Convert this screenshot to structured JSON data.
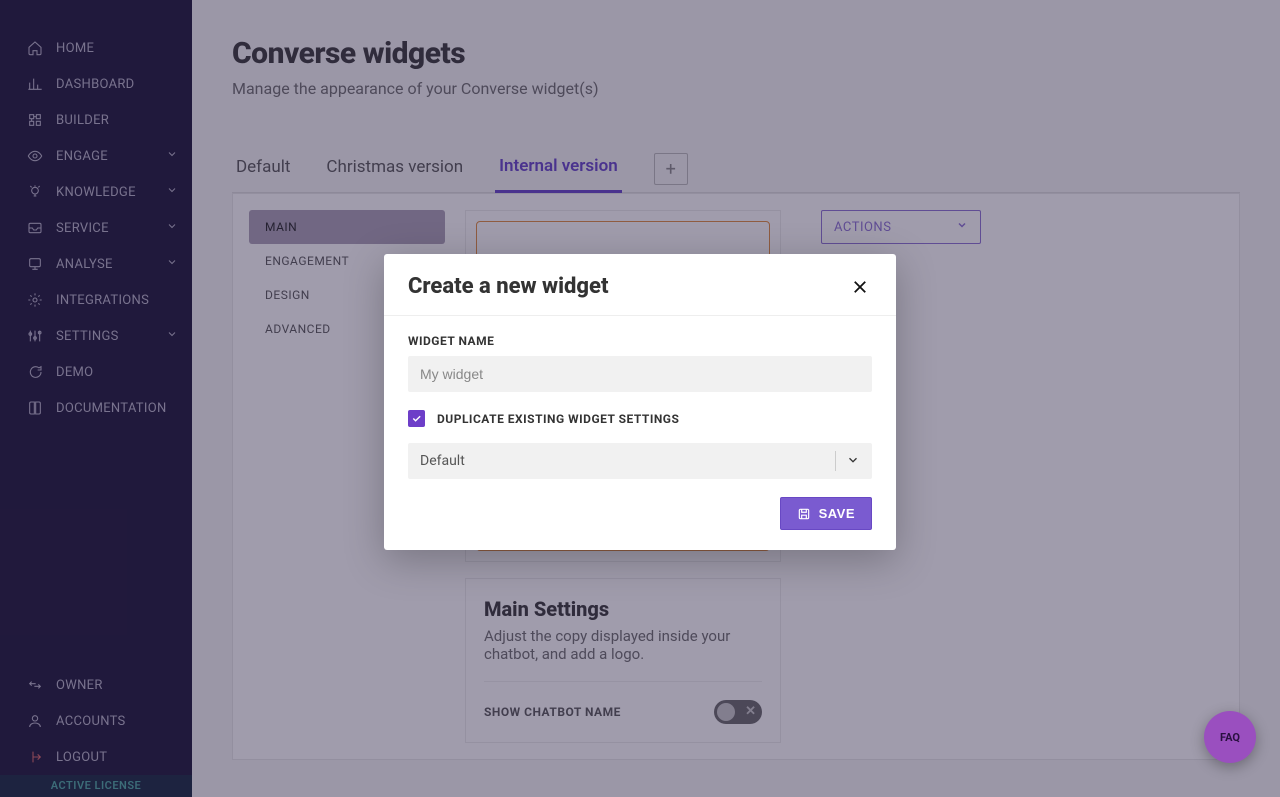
{
  "sidebar": {
    "items": [
      {
        "label": "HOME",
        "expandable": false
      },
      {
        "label": "DASHBOARD",
        "expandable": false
      },
      {
        "label": "BUILDER",
        "expandable": false
      },
      {
        "label": "ENGAGE",
        "expandable": true
      },
      {
        "label": "KNOWLEDGE",
        "expandable": true
      },
      {
        "label": "SERVICE",
        "expandable": true
      },
      {
        "label": "ANALYSE",
        "expandable": true
      },
      {
        "label": "INTEGRATIONS",
        "expandable": false
      },
      {
        "label": "SETTINGS",
        "expandable": true
      },
      {
        "label": "DEMO",
        "expandable": false
      },
      {
        "label": "DOCUMENTATION",
        "expandable": false
      }
    ],
    "bottom": [
      {
        "label": "OWNER"
      },
      {
        "label": "ACCOUNTS"
      },
      {
        "label": "LOGOUT"
      }
    ],
    "active_license": "ACTIVE LICENSE"
  },
  "page": {
    "title": "Converse widgets",
    "subtitle": "Manage the appearance of your Converse widget(s)"
  },
  "tabs": {
    "items": [
      {
        "label": "Default",
        "active": false
      },
      {
        "label": "Christmas version",
        "active": false
      },
      {
        "label": "Internal version",
        "active": true
      }
    ],
    "add": "+"
  },
  "side_tabs": [
    {
      "label": "MAIN",
      "active": true
    },
    {
      "label": "ENGAGEMENT",
      "active": false
    },
    {
      "label": "DESIGN",
      "active": false
    },
    {
      "label": "ADVANCED",
      "active": false
    }
  ],
  "actions": {
    "label": "ACTIONS"
  },
  "main_settings": {
    "title": "Main Settings",
    "description": "Adjust the copy displayed inside your chatbot, and add a logo.",
    "toggle_label": "SHOW CHATBOT NAME",
    "toggle_on": false
  },
  "modal": {
    "title": "Create a new widget",
    "field_label": "WIDGET NAME",
    "placeholder": "My widget",
    "value": "",
    "duplicate_label": "DUPLICATE EXISTING WIDGET SETTINGS",
    "duplicate_checked": true,
    "select_value": "Default",
    "save_label": "SAVE"
  },
  "fab": {
    "label": "FAQ"
  },
  "colors": {
    "accent": "#6d3ec8",
    "sidebar_bg": "#171133"
  }
}
